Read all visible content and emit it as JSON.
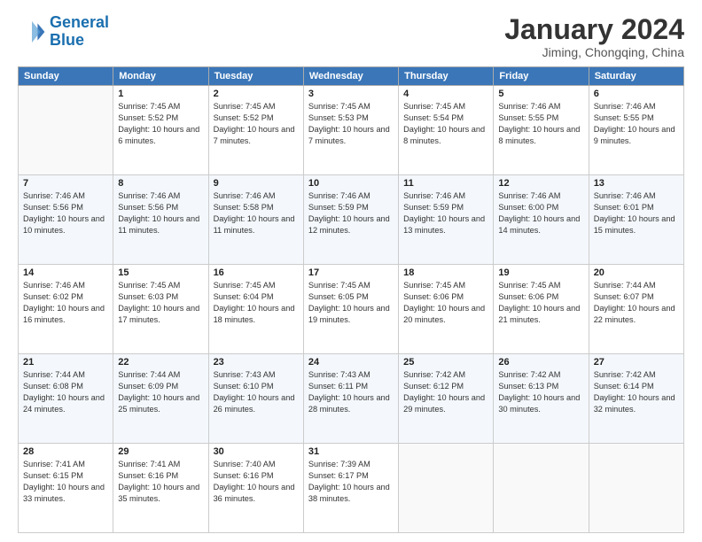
{
  "header": {
    "logo_line1": "General",
    "logo_line2": "Blue",
    "main_title": "January 2024",
    "subtitle": "Jiming, Chongqing, China"
  },
  "days_of_week": [
    "Sunday",
    "Monday",
    "Tuesday",
    "Wednesday",
    "Thursday",
    "Friday",
    "Saturday"
  ],
  "weeks": [
    [
      {
        "day": "",
        "empty": true
      },
      {
        "day": "1",
        "sunrise": "7:45 AM",
        "sunset": "5:52 PM",
        "daylight": "10 hours and 6 minutes."
      },
      {
        "day": "2",
        "sunrise": "7:45 AM",
        "sunset": "5:52 PM",
        "daylight": "10 hours and 7 minutes."
      },
      {
        "day": "3",
        "sunrise": "7:45 AM",
        "sunset": "5:53 PM",
        "daylight": "10 hours and 7 minutes."
      },
      {
        "day": "4",
        "sunrise": "7:45 AM",
        "sunset": "5:54 PM",
        "daylight": "10 hours and 8 minutes."
      },
      {
        "day": "5",
        "sunrise": "7:46 AM",
        "sunset": "5:55 PM",
        "daylight": "10 hours and 8 minutes."
      },
      {
        "day": "6",
        "sunrise": "7:46 AM",
        "sunset": "5:55 PM",
        "daylight": "10 hours and 9 minutes."
      }
    ],
    [
      {
        "day": "7",
        "sunrise": "7:46 AM",
        "sunset": "5:56 PM",
        "daylight": "10 hours and 10 minutes."
      },
      {
        "day": "8",
        "sunrise": "7:46 AM",
        "sunset": "5:56 PM",
        "daylight": "10 hours and 11 minutes."
      },
      {
        "day": "9",
        "sunrise": "7:46 AM",
        "sunset": "5:58 PM",
        "daylight": "10 hours and 11 minutes."
      },
      {
        "day": "10",
        "sunrise": "7:46 AM",
        "sunset": "5:59 PM",
        "daylight": "10 hours and 12 minutes."
      },
      {
        "day": "11",
        "sunrise": "7:46 AM",
        "sunset": "5:59 PM",
        "daylight": "10 hours and 13 minutes."
      },
      {
        "day": "12",
        "sunrise": "7:46 AM",
        "sunset": "6:00 PM",
        "daylight": "10 hours and 14 minutes."
      },
      {
        "day": "13",
        "sunrise": "7:46 AM",
        "sunset": "6:01 PM",
        "daylight": "10 hours and 15 minutes."
      }
    ],
    [
      {
        "day": "14",
        "sunrise": "7:46 AM",
        "sunset": "6:02 PM",
        "daylight": "10 hours and 16 minutes."
      },
      {
        "day": "15",
        "sunrise": "7:45 AM",
        "sunset": "6:03 PM",
        "daylight": "10 hours and 17 minutes."
      },
      {
        "day": "16",
        "sunrise": "7:45 AM",
        "sunset": "6:04 PM",
        "daylight": "10 hours and 18 minutes."
      },
      {
        "day": "17",
        "sunrise": "7:45 AM",
        "sunset": "6:05 PM",
        "daylight": "10 hours and 19 minutes."
      },
      {
        "day": "18",
        "sunrise": "7:45 AM",
        "sunset": "6:06 PM",
        "daylight": "10 hours and 20 minutes."
      },
      {
        "day": "19",
        "sunrise": "7:45 AM",
        "sunset": "6:06 PM",
        "daylight": "10 hours and 21 minutes."
      },
      {
        "day": "20",
        "sunrise": "7:44 AM",
        "sunset": "6:07 PM",
        "daylight": "10 hours and 22 minutes."
      }
    ],
    [
      {
        "day": "21",
        "sunrise": "7:44 AM",
        "sunset": "6:08 PM",
        "daylight": "10 hours and 24 minutes."
      },
      {
        "day": "22",
        "sunrise": "7:44 AM",
        "sunset": "6:09 PM",
        "daylight": "10 hours and 25 minutes."
      },
      {
        "day": "23",
        "sunrise": "7:43 AM",
        "sunset": "6:10 PM",
        "daylight": "10 hours and 26 minutes."
      },
      {
        "day": "24",
        "sunrise": "7:43 AM",
        "sunset": "6:11 PM",
        "daylight": "10 hours and 28 minutes."
      },
      {
        "day": "25",
        "sunrise": "7:42 AM",
        "sunset": "6:12 PM",
        "daylight": "10 hours and 29 minutes."
      },
      {
        "day": "26",
        "sunrise": "7:42 AM",
        "sunset": "6:13 PM",
        "daylight": "10 hours and 30 minutes."
      },
      {
        "day": "27",
        "sunrise": "7:42 AM",
        "sunset": "6:14 PM",
        "daylight": "10 hours and 32 minutes."
      }
    ],
    [
      {
        "day": "28",
        "sunrise": "7:41 AM",
        "sunset": "6:15 PM",
        "daylight": "10 hours and 33 minutes."
      },
      {
        "day": "29",
        "sunrise": "7:41 AM",
        "sunset": "6:16 PM",
        "daylight": "10 hours and 35 minutes."
      },
      {
        "day": "30",
        "sunrise": "7:40 AM",
        "sunset": "6:16 PM",
        "daylight": "10 hours and 36 minutes."
      },
      {
        "day": "31",
        "sunrise": "7:39 AM",
        "sunset": "6:17 PM",
        "daylight": "10 hours and 38 minutes."
      },
      {
        "day": "",
        "empty": true
      },
      {
        "day": "",
        "empty": true
      },
      {
        "day": "",
        "empty": true
      }
    ]
  ]
}
